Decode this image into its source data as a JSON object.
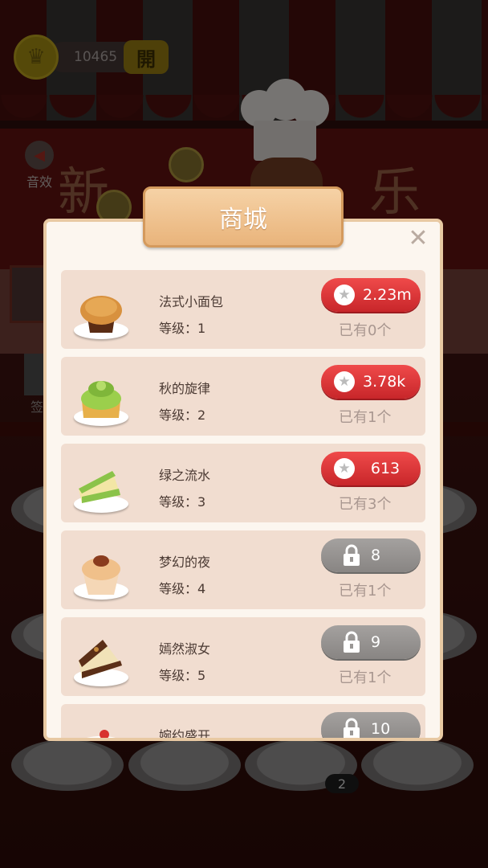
{
  "hud": {
    "coins": "10465",
    "open_label": "開",
    "sound_label": "音效",
    "checkin_label": "签"
  },
  "scene": {
    "banner_chars": [
      "新",
      "乐"
    ],
    "plate_badge": "2"
  },
  "shop": {
    "title": "商城",
    "close_icon": "close-icon",
    "items": [
      {
        "name": "法式小面包",
        "level": "等级：1",
        "price": "2.23m",
        "owned": "已有0个",
        "locked": false,
        "cake": "muffin"
      },
      {
        "name": "秋的旋律",
        "level": "等级：2",
        "price": "3.78k",
        "owned": "已有1个",
        "locked": false,
        "cake": "kiwi-tart"
      },
      {
        "name": "绿之流水",
        "level": "等级：3",
        "price": "613",
        "owned": "已有3个",
        "locked": false,
        "cake": "green-cake-slice"
      },
      {
        "name": "梦幻的夜",
        "level": "等级：4",
        "price": "8",
        "owned": "已有1个",
        "locked": true,
        "cake": "cupcake"
      },
      {
        "name": "嫣然淑女",
        "level": "等级：5",
        "price": "9",
        "owned": "已有1个",
        "locked": true,
        "cake": "chocolate-cake-slice"
      },
      {
        "name": "婉约盛开",
        "level": "",
        "price": "10",
        "owned": "",
        "locked": true,
        "cake": "strawberry-cake"
      }
    ]
  },
  "colors": {
    "buy_button": "#e0393b",
    "locked_button": "#989593",
    "modal_bg": "#fcf6ef",
    "row_bg": "#f1ddd0",
    "title_bg": "#eec293"
  }
}
